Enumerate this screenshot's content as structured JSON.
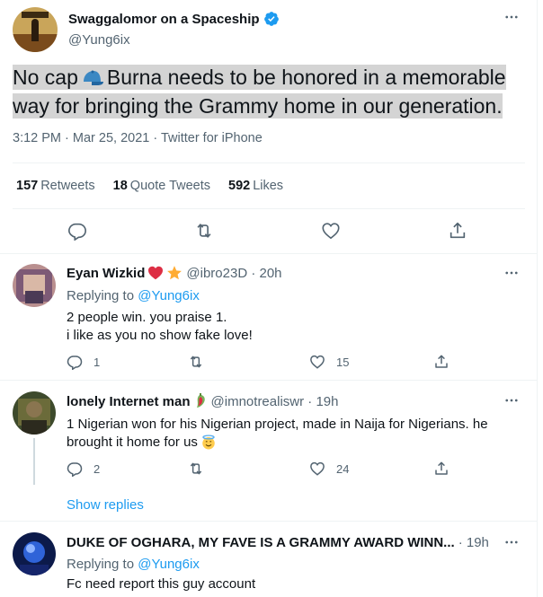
{
  "main_tweet": {
    "display_name": "Swaggalomor on a Spaceship",
    "handle": "@Yung6ix",
    "text_before_emoji": "No cap",
    "text_after_emoji": "Burna needs to be honored in a memorable way for bringing the Grammy home in our generation.",
    "timestamp": "3:12 PM · Mar 25, 2021 · Twitter for iPhone",
    "stats": {
      "retweets_count": "157",
      "retweets_label": "Retweets",
      "quotes_count": "18",
      "quotes_label": "Quote Tweets",
      "likes_count": "592",
      "likes_label": "Likes"
    }
  },
  "replies": [
    {
      "display_name": "Eyan Wizkid",
      "handle_time": "@ibro23D · 20h",
      "replying_prefix": "Replying to",
      "replying_to": "@Yung6ix",
      "line1": "2 people win. you praise 1.",
      "line2": "i like as you no show fake love!",
      "reply_count": "1",
      "retweet_count": "",
      "like_count": "15"
    },
    {
      "display_name": "lonely Internet man",
      "handle_time": "@imnotrealiswr · 19h",
      "line1": "1 Nigerian won for his Nigerian project, made in Naija for Nigerians. he",
      "line2": "brought it home for us",
      "reply_count": "2",
      "retweet_count": "",
      "like_count": "24"
    },
    {
      "display_name": "DUKE OF OGHARA, MY FAVE IS A GRAMMY AWARD WINN...",
      "handle_time": "· 19h",
      "replying_prefix": "Replying to",
      "replying_to": "@Yung6ix",
      "line1": "Fc need report this guy account"
    }
  ],
  "show_replies_label": "Show replies",
  "colors": {
    "accent": "#1d9bf0",
    "secondary_text": "#536471",
    "highlight": "#d4d4d4"
  }
}
